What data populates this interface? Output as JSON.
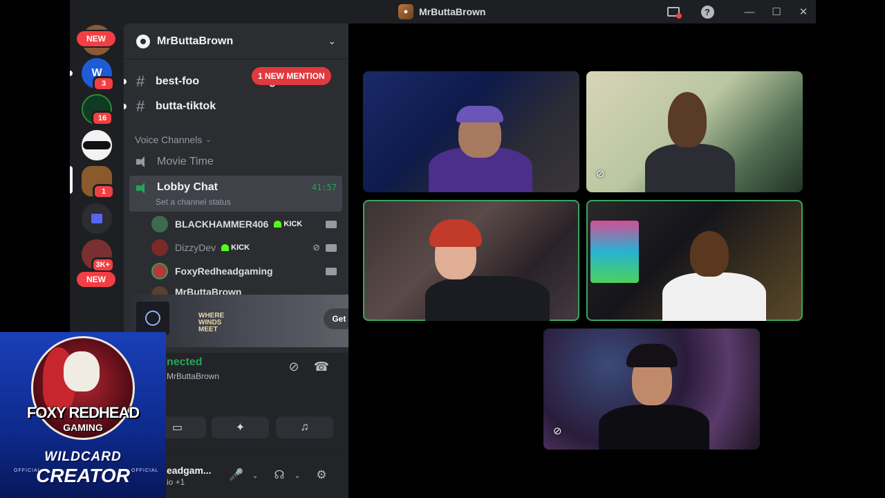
{
  "window": {
    "title": "MrButtaBrown"
  },
  "rail": {
    "badges": {
      "s1": "3",
      "s2": "16",
      "s5": "1",
      "s7": "3K+"
    },
    "new_label_top": "NEW",
    "new_label_bottom": "NEW"
  },
  "guild": {
    "name": "MrButtaBrown"
  },
  "channels": {
    "best_food": "best-foo",
    "best_food_tail": "g",
    "butta_tiktok": "butta-tiktok",
    "mention_pill": "1 NEW MENTION"
  },
  "voice": {
    "header": "Voice Channels",
    "movie_time": "Movie Time",
    "lobby": "Lobby Chat",
    "lobby_timer": "41:57",
    "lobby_status": "Set a channel status",
    "users": [
      {
        "name": "BLACKHAMMER406",
        "kick": "KICK"
      },
      {
        "name": "DizzyDev",
        "kick": "KICK"
      },
      {
        "name": "FoxyRedheadgaming"
      },
      {
        "name": "MrButtaBrown"
      }
    ]
  },
  "promo": {
    "brand": "WHERE WINDS MEET",
    "button": "Get Reward!"
  },
  "connection": {
    "status": "nected",
    "server": "MrButtaBrown"
  },
  "user_panel": {
    "name": "eadgam...",
    "sub": "io +1"
  },
  "overlay": {
    "title": "FOXY REDHEAD",
    "subtitle": "GAMING",
    "brand": "WILDCARD",
    "creator": "CREATOR",
    "official_left": "OFFICIAL",
    "official_right": "OFFICIAL"
  },
  "colors": {
    "accent_green": "#23a55a",
    "danger_red": "#f23f43",
    "sidebar_bg": "#2b2d31",
    "rail_bg": "#1e1f22"
  }
}
